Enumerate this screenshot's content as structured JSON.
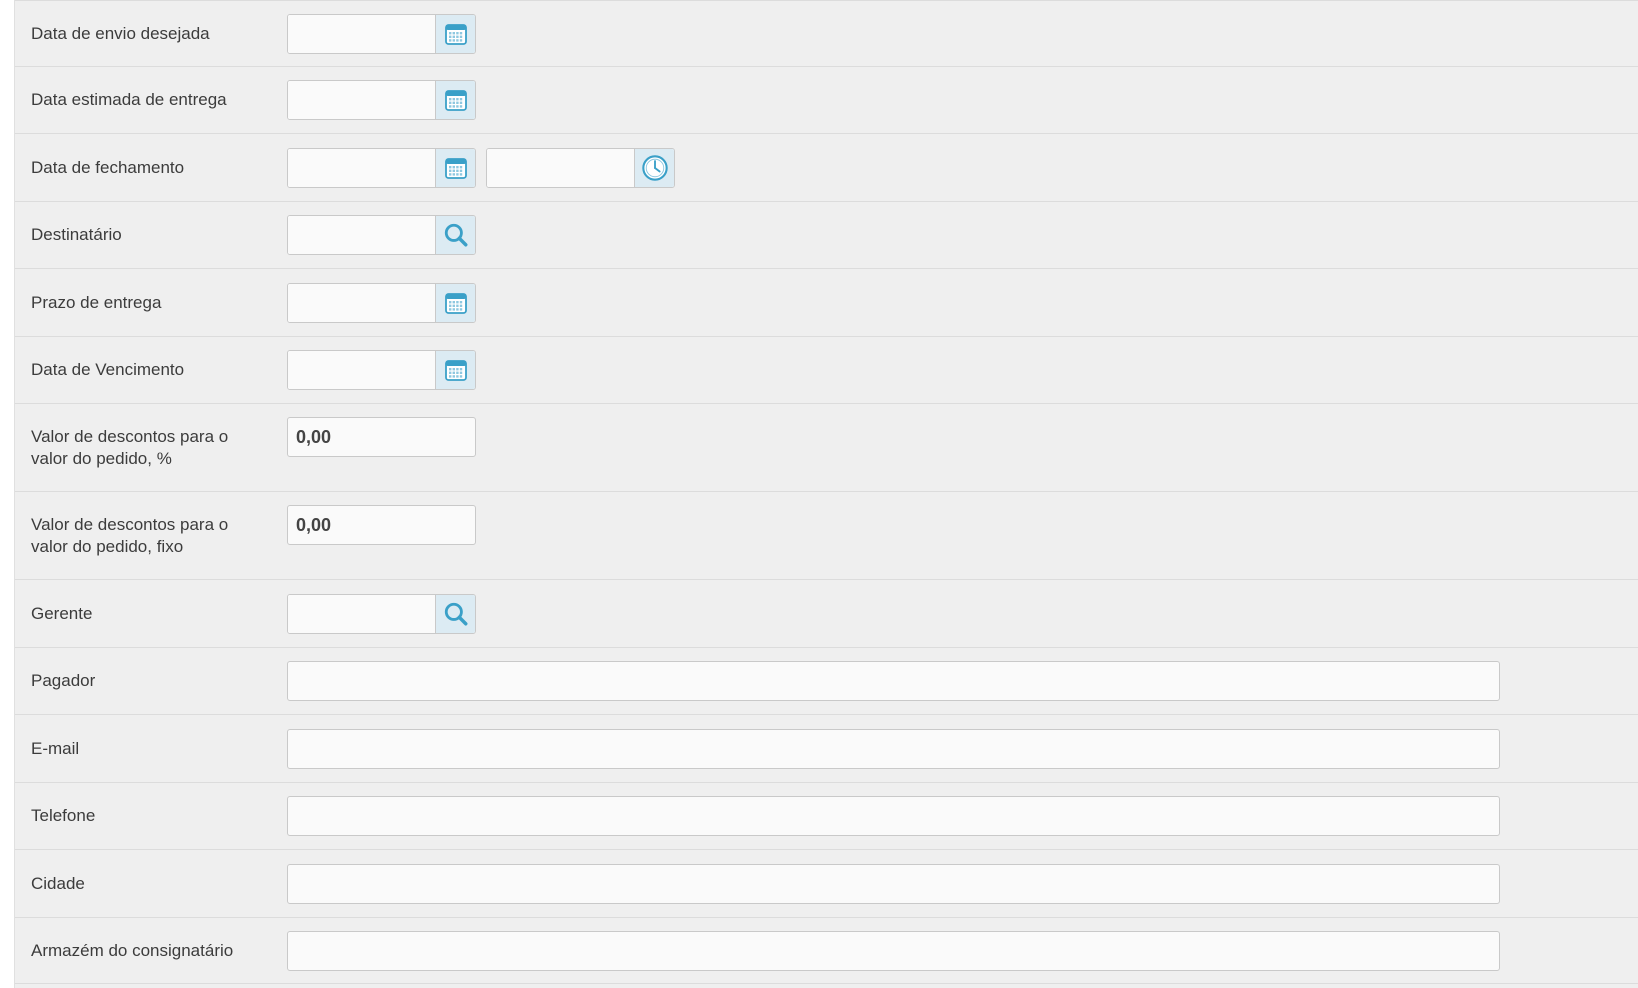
{
  "fields": [
    {
      "label": "Data de envio desejada",
      "value": "",
      "icon": "calendar-icon"
    },
    {
      "label": "Data estimada de entrega",
      "value": "",
      "icon": "calendar-icon"
    },
    {
      "label": "Data de fechamento",
      "value": "",
      "time_value": "",
      "icon": "calendar-icon",
      "time_icon": "clock-icon"
    },
    {
      "label": "Destinatário",
      "value": "",
      "icon": "search-icon"
    },
    {
      "label": "Prazo de entrega",
      "value": "",
      "icon": "calendar-icon"
    },
    {
      "label": "Data de Vencimento",
      "value": "",
      "icon": "calendar-icon"
    },
    {
      "label_line1": "Valor de descontos para o",
      "label_line2": "valor do pedido, %",
      "value": "0,00"
    },
    {
      "label_line1": "Valor de descontos para o",
      "label_line2": "valor do pedido, fixo",
      "value": "0,00"
    },
    {
      "label": "Gerente",
      "value": "",
      "icon": "search-icon"
    },
    {
      "label": "Pagador",
      "value": ""
    },
    {
      "label": "E-mail",
      "value": ""
    },
    {
      "label": "Telefone",
      "value": ""
    },
    {
      "label": "Cidade",
      "value": ""
    },
    {
      "label": "Armazém do consignatário",
      "value": ""
    }
  ],
  "colors": {
    "background": "#efefef",
    "icon": "#3aa0c8",
    "button_bg": "#dcebf3"
  }
}
